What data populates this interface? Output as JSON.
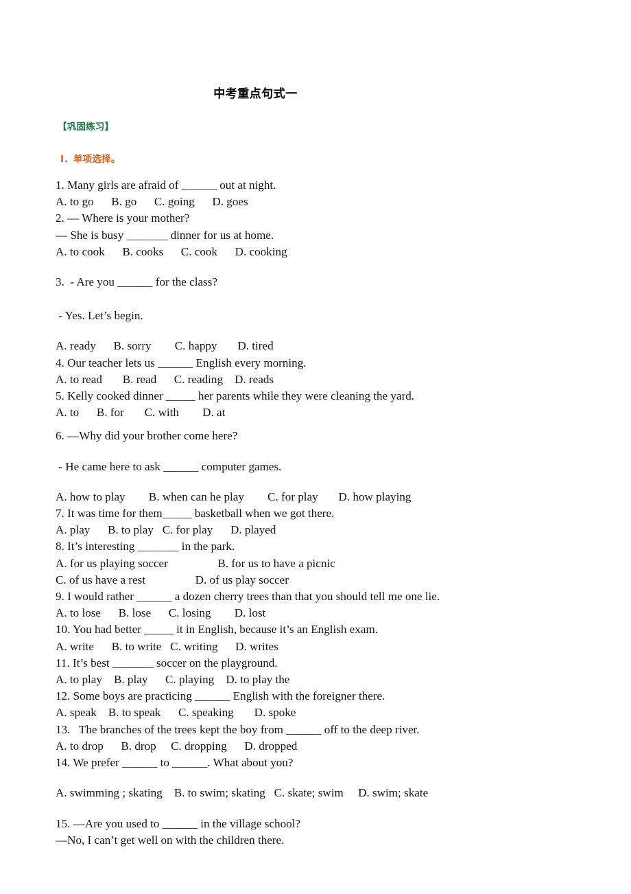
{
  "document": {
    "title": "中考重点句式一",
    "section_practice": "【巩固练习】",
    "section_multiple_choice": "Ⅰ．单项选择。",
    "colors": {
      "title": "#000000",
      "practice_heading": "#1d7a46",
      "choice_heading": "#e2621a",
      "body_text": "#151515",
      "page_background": "#ffffff"
    }
  },
  "questions": [
    {
      "number": "1",
      "lines": [
        "1. Many girls are afraid of ______ out at night.",
        "A. to go      B. go      C. going      D. goes"
      ]
    },
    {
      "number": "2",
      "lines": [
        "2. — Where is your mother?",
        "— She is busy _______ dinner for us at home.",
        "A. to cook      B. cooks      C. cook      D. cooking"
      ]
    },
    {
      "number": "3",
      "lines": [
        "3.  - Are you ______ for the class?",
        " - Yes. Let’s begin.",
        "A. ready      B. sorry        C. happy       D. tired"
      ]
    },
    {
      "number": "4",
      "lines": [
        "4. Our teacher lets us ______ English every morning.",
        "A. to read       B. read      C. reading    D. reads"
      ]
    },
    {
      "number": "5",
      "lines": [
        "5. Kelly cooked dinner _____ her parents while they were cleaning the yard.",
        "A. to      B. for       C. with        D. at"
      ]
    },
    {
      "number": "6",
      "lines": [
        "6. —Why did your brother come here?",
        " - He came here to ask ______ computer games.",
        "A. how to play        B. when can he play        C. for play       D. how playing"
      ]
    },
    {
      "number": "7",
      "lines": [
        "7. It was time for them_____ basketball when we got there.",
        "A. play      B. to play   C. for play      D. played"
      ]
    },
    {
      "number": "8",
      "lines": [
        "8. It’s interesting _______ in the park.",
        "A. for us playing soccer                 B. for us to have a picnic",
        "C. of us have a rest                 D. of us play soccer"
      ]
    },
    {
      "number": "9",
      "lines": [
        "9. I would rather ______ a dozen cherry trees than that you should tell me one lie.",
        "A. to lose      B. lose      C. losing        D. lost"
      ]
    },
    {
      "number": "10",
      "lines": [
        "10. You had better _____ it in English, because it’s an English exam.",
        "A. write      B. to write   C. writing      D. writes"
      ]
    },
    {
      "number": "11",
      "lines": [
        "11. It’s best _______ soccer on the playground.",
        "A. to play    B. play      C. playing    D. to play the"
      ]
    },
    {
      "number": "12",
      "lines": [
        "12. Some boys are practicing ______ English with the foreigner there.",
        "A. speak    B. to speak      C. speaking       D. spoke"
      ]
    },
    {
      "number": "13",
      "lines": [
        "13.   The branches of the trees kept the boy from ______ off to the deep river.",
        "A. to drop      B. drop     C. dropping      D. dropped"
      ]
    },
    {
      "number": "14",
      "lines": [
        "14. We prefer ______ to ______. What about you?",
        "A. swimming ; skating    B. to swim; skating   C. skate; swim     D. swim; skate"
      ]
    },
    {
      "number": "15",
      "lines": [
        "15. —Are you used to ______ in the village school?",
        "—No, I can’t get well on with the children there."
      ]
    }
  ]
}
